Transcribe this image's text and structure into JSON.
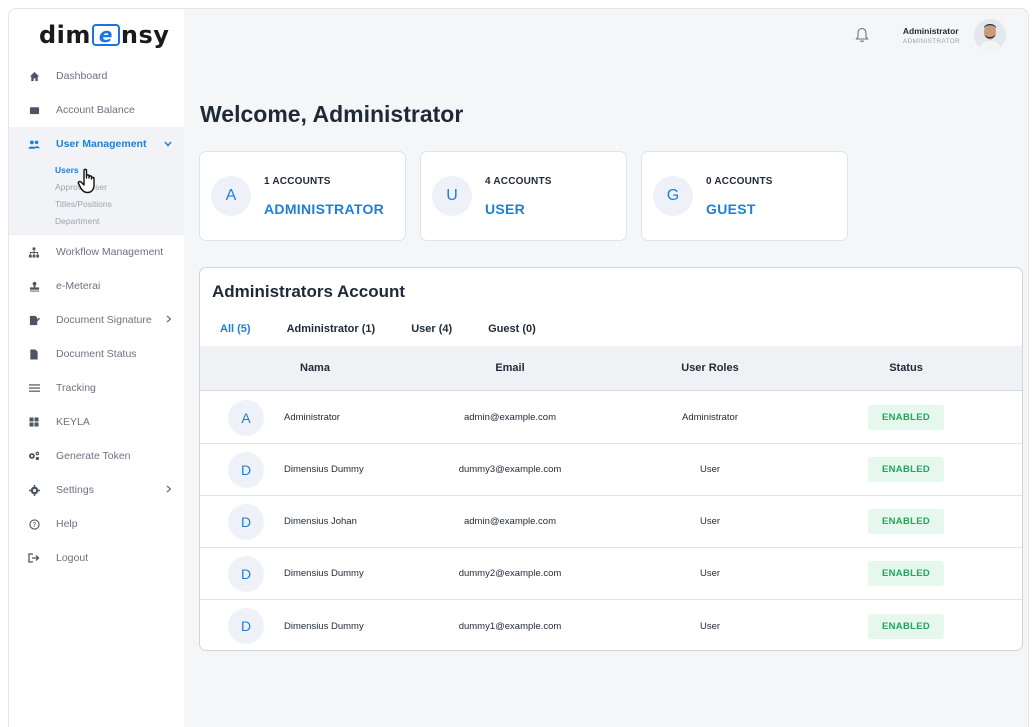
{
  "brand": {
    "logo_prefix": "dim",
    "logo_e": "e",
    "logo_suffix": "nsy"
  },
  "sidebar": {
    "items": [
      {
        "label": "Dashboard",
        "icon": "home-icon"
      },
      {
        "label": "Account Balance",
        "icon": "wallet-icon"
      },
      {
        "label": "User Management",
        "icon": "users-icon"
      },
      {
        "label": "Workflow Management",
        "icon": "sitemap-icon"
      },
      {
        "label": "e-Meterai",
        "icon": "stamp-icon"
      },
      {
        "label": "Document Signature",
        "icon": "signature-icon"
      },
      {
        "label": "Document Status",
        "icon": "document-icon"
      },
      {
        "label": "Tracking",
        "icon": "list-icon"
      },
      {
        "label": "KEYLA",
        "icon": "grid-icon"
      },
      {
        "label": "Generate Token",
        "icon": "cogs-icon"
      },
      {
        "label": "Settings",
        "icon": "gear-icon"
      },
      {
        "label": "Help",
        "icon": "help-icon"
      },
      {
        "label": "Logout",
        "icon": "logout-icon"
      }
    ],
    "sub_items": [
      "Users",
      "Approve User",
      "Titles/Positions",
      "Department"
    ]
  },
  "header": {
    "user_name": "Administrator",
    "user_role": "ADMINISTRATOR"
  },
  "page": {
    "title": "Welcome, Administrator"
  },
  "stats": [
    {
      "initial": "A",
      "count": "1 ACCOUNTS",
      "role": "ADMINISTRATOR"
    },
    {
      "initial": "U",
      "count": "4 ACCOUNTS",
      "role": "USER"
    },
    {
      "initial": "G",
      "count": "0 ACCOUNTS",
      "role": "GUEST"
    }
  ],
  "table": {
    "title": "Administrators Account",
    "tabs": [
      "All (5)",
      "Administrator (1)",
      "User (4)",
      "Guest (0)"
    ],
    "headers": {
      "name": "Nama",
      "email": "Email",
      "roles": "User Roles",
      "status": "Status"
    },
    "rows": [
      {
        "initial": "A",
        "name": "Administrator",
        "email": "admin@example.com",
        "role": "Administrator",
        "status": "ENABLED"
      },
      {
        "initial": "D",
        "name": "Dimensius Dummy",
        "email": "dummy3@example.com",
        "role": "User",
        "status": "ENABLED"
      },
      {
        "initial": "D",
        "name": "Dimensius Johan",
        "email": "admin@example.com",
        "role": "User",
        "status": "ENABLED"
      },
      {
        "initial": "D",
        "name": "Dimensius Dummy",
        "email": "dummy2@example.com",
        "role": "User",
        "status": "ENABLED"
      },
      {
        "initial": "D",
        "name": "Dimensius Dummy",
        "email": "dummy1@example.com",
        "role": "User",
        "status": "ENABLED"
      }
    ]
  },
  "colors": {
    "accent": "#1d7fd6",
    "status_bg": "#e6f7ee",
    "status_text": "#22a55a"
  }
}
